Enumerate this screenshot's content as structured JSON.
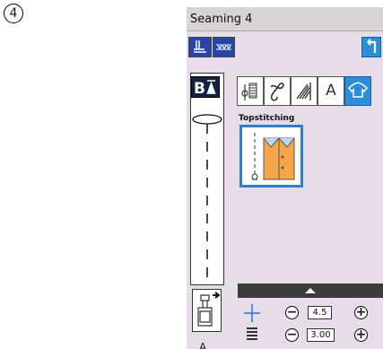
{
  "step_number": "4",
  "screen": {
    "title": "Seaming 4",
    "section_label": "Topstitching",
    "category_tabs": [
      "A"
    ],
    "presser_foot": "A",
    "width": {
      "value": "4.5",
      "minus": "−",
      "plus": "+"
    },
    "length": {
      "value": "3.00",
      "minus": "−",
      "plus": "+"
    },
    "icons": {
      "needle_position": "needle-position-icon",
      "pattern_select": "pattern-select-icon",
      "back": "back-arrow-icon",
      "mirror": "mirror-image-icon",
      "width": "stitch-width-icon",
      "length": "stitch-length-icon",
      "scroll_up": "scroll-up-icon"
    },
    "colors": {
      "accent": "#2b8ed6",
      "panel": "#e6dde9",
      "dark_button": "#2745a6"
    }
  }
}
